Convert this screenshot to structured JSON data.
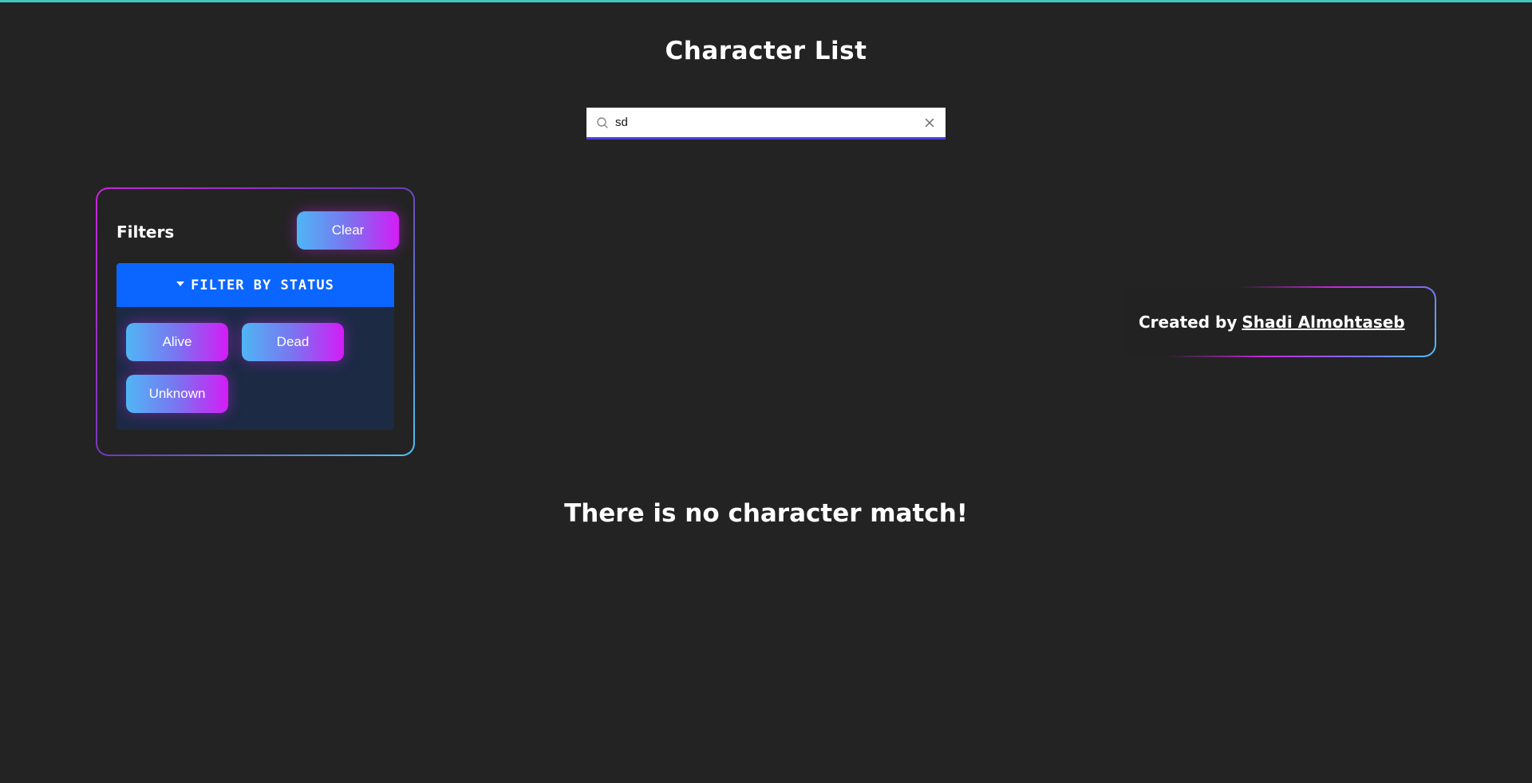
{
  "page": {
    "title": "Character List",
    "accent_color": "#3fc7c0",
    "background_color": "#232323"
  },
  "search": {
    "value": "sd",
    "icon": "search-icon",
    "clear_icon": "close-icon"
  },
  "filters": {
    "title": "Filters",
    "clear_label": "Clear",
    "status_header": "FILTER BY STATUS",
    "status_options": [
      "Alive",
      "Dead",
      "Unknown"
    ],
    "header_color": "#0a66ff"
  },
  "credit": {
    "prefix": "Created by",
    "author": "Shadi Almohtaseb"
  },
  "results": {
    "empty_message": "There is no character match!"
  }
}
